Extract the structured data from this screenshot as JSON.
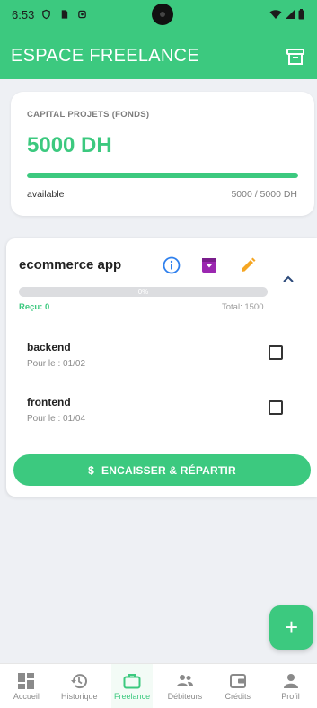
{
  "status_bar": {
    "time": "6:53"
  },
  "app_bar": {
    "title": "ESPACE FREELANCE",
    "archive_icon": "archive-icon"
  },
  "capital": {
    "label": "CAPITAL PROJETS (FONDS)",
    "amount": "5000 DH",
    "progress_fraction": 1.0,
    "available_label": "available",
    "ratio": "5000 / 5000 DH"
  },
  "project": {
    "name": "ecommerce app",
    "progress_percent_label": "0%",
    "progress_fraction": 0.0,
    "received": "Reçu: 0",
    "total": "Total: 1500",
    "tasks": [
      {
        "name": "backend",
        "due": "Pour le : 01/02",
        "checked": false
      },
      {
        "name": "frontend",
        "due": "Pour le : 01/04",
        "checked": false
      }
    ],
    "cash_button": {
      "icon": "$",
      "label": "ENCAISSER & RÉPARTIR"
    }
  },
  "fab": {
    "label": "+"
  },
  "bottom_nav": [
    {
      "label": "Accueil",
      "icon": "dashboard-icon",
      "active": false
    },
    {
      "label": "Historique",
      "icon": "history-icon",
      "active": false
    },
    {
      "label": "Freelance",
      "icon": "briefcase-icon",
      "active": true
    },
    {
      "label": "Débiteurs",
      "icon": "people-icon",
      "active": false
    },
    {
      "label": "Crédits",
      "icon": "wallet-icon",
      "active": false
    },
    {
      "label": "Profil",
      "icon": "person-icon",
      "active": false
    }
  ],
  "colors": {
    "primary": "#3cc97f",
    "info": "#2f80ed",
    "archive": "#9b27b0",
    "edit": "#f5a623"
  }
}
